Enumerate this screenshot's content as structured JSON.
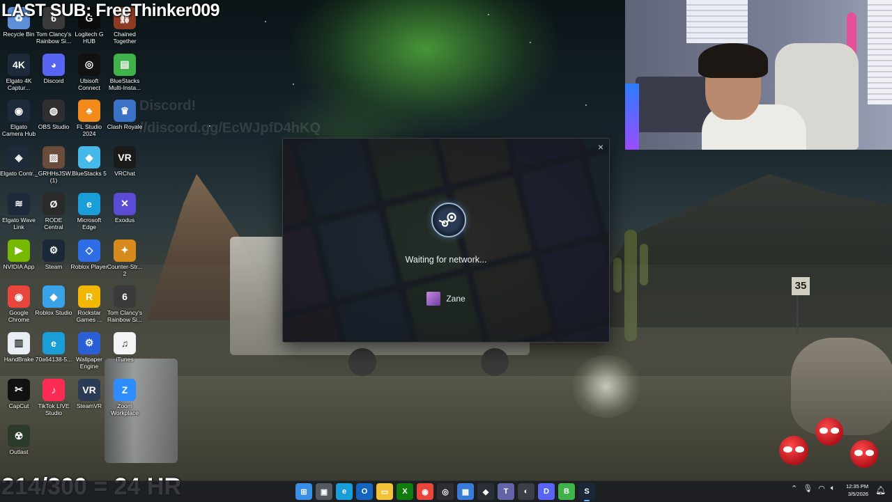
{
  "overlay": {
    "last_sub": "LAST SUB: FreeThinker009",
    "subgoal": "214/300 = 24 HR",
    "faint_line1": "Discord!",
    "faint_line2": "//discord.gg/EcWJpfD4hKQ"
  },
  "desktop_icons": [
    {
      "label": "Recycle Bin",
      "icon": "recycle-bin-icon",
      "color": "#5d8fd6"
    },
    {
      "label": "Tom Clancy's Rainbow Si...",
      "icon": "rainbow-six-icon",
      "color": "#3a3a3a"
    },
    {
      "label": "Logitech G HUB",
      "icon": "logitech-icon",
      "color": "#0b0b0b"
    },
    {
      "label": "Chained Together",
      "icon": "chained-together-icon",
      "color": "#8a3b22"
    },
    {
      "label": "Elgato 4K Captur...",
      "icon": "elgato-4k-icon",
      "color": "#1e2a3a"
    },
    {
      "label": "Discord",
      "icon": "discord-icon",
      "color": "#5865f2"
    },
    {
      "label": "Ubisoft Connect",
      "icon": "ubisoft-icon",
      "color": "#111111"
    },
    {
      "label": "BlueStacks Multi-Insta...",
      "icon": "bluestacks-multi-icon",
      "color": "#3fb24a"
    },
    {
      "label": "Elgato Camera Hub",
      "icon": "elgato-camera-icon",
      "color": "#1e2a3a"
    },
    {
      "label": "OBS Studio",
      "icon": "obs-icon",
      "color": "#302e31"
    },
    {
      "label": "FL Studio 2024",
      "icon": "fl-studio-icon",
      "color": "#f28b1c"
    },
    {
      "label": "Clash Royale",
      "icon": "clash-royale-icon",
      "color": "#3a72c8"
    },
    {
      "label": "Elgato Contr...",
      "icon": "elgato-control-icon",
      "color": "#1e2a3a"
    },
    {
      "label": "_GRHHsJSW... (1)",
      "icon": "image-file-icon",
      "color": "#6b4b3a"
    },
    {
      "label": "BlueStacks 5",
      "icon": "bluestacks-icon",
      "color": "#46b9e8"
    },
    {
      "label": "VRChat",
      "icon": "vrchat-icon",
      "color": "#1a1a1a"
    },
    {
      "label": "Elgato Wave Link",
      "icon": "wave-link-icon",
      "color": "#1e2a3a"
    },
    {
      "label": "RODE Central",
      "icon": "rode-icon",
      "color": "#2a2a2a"
    },
    {
      "label": "Microsoft Edge",
      "icon": "edge-icon",
      "color": "#1a9ed8"
    },
    {
      "label": "Exodus",
      "icon": "exodus-icon",
      "color": "#5b4bd6"
    },
    {
      "label": "NVIDIA App",
      "icon": "nvidia-icon",
      "color": "#76b900"
    },
    {
      "label": "Steam",
      "icon": "steam-icon",
      "color": "#1b2838"
    },
    {
      "label": "Roblox Player",
      "icon": "roblox-icon",
      "color": "#2e6de6"
    },
    {
      "label": "Counter-Str... 2",
      "icon": "counter-strike-icon",
      "color": "#d88a1c"
    },
    {
      "label": "Google Chrome",
      "icon": "chrome-icon",
      "color": "#e8453c"
    },
    {
      "label": "Roblox Studio",
      "icon": "roblox-studio-icon",
      "color": "#3aa3e8"
    },
    {
      "label": "Rockstar Games ...",
      "icon": "rockstar-icon",
      "color": "#f2b705"
    },
    {
      "label": "Tom Clancy's Rainbow Si...",
      "icon": "rainbow-six-icon",
      "color": "#3a3a3a"
    },
    {
      "label": "HandBrake",
      "icon": "handbrake-icon",
      "color": "#e8eef4"
    },
    {
      "label": "70a64138-5...",
      "icon": "edge-file-icon",
      "color": "#1a9ed8"
    },
    {
      "label": "Wallpaper Engine",
      "icon": "wallpaper-engine-icon",
      "color": "#2a5fd6"
    },
    {
      "label": "iTunes",
      "icon": "itunes-icon",
      "color": "#f4f4f4"
    },
    {
      "label": "CapCut",
      "icon": "capcut-icon",
      "color": "#111111"
    },
    {
      "label": "TikTok LIVE Studio",
      "icon": "tiktok-live-icon",
      "color": "#fe2c55"
    },
    {
      "label": "SteamVR",
      "icon": "steamvr-icon",
      "color": "#2b3b55"
    },
    {
      "label": "Zoom Workplace",
      "icon": "zoom-icon",
      "color": "#2d8cff"
    },
    {
      "label": "Outlast",
      "icon": "outlast-icon",
      "color": "#2b3a2b"
    }
  ],
  "dialog": {
    "close_glyph": "×",
    "status": "Waiting for network...",
    "username": "Zane"
  },
  "wallpaper": {
    "sign_text": "35"
  },
  "taskbar": {
    "apps": [
      {
        "name": "start-button",
        "glyph": "⊞",
        "color": "#3a8ee6"
      },
      {
        "name": "task-view-icon",
        "glyph": "▣",
        "color": "#555a60"
      },
      {
        "name": "edge-taskbar-icon",
        "glyph": "e",
        "color": "#1a9ed8"
      },
      {
        "name": "outlook-taskbar-icon",
        "glyph": "O",
        "color": "#1565c0"
      },
      {
        "name": "file-explorer-icon",
        "glyph": "▭",
        "color": "#f2c23a"
      },
      {
        "name": "xbox-taskbar-icon",
        "glyph": "X",
        "color": "#107c10"
      },
      {
        "name": "chrome-taskbar-icon",
        "glyph": "◉",
        "color": "#e8453c"
      },
      {
        "name": "obs-taskbar-icon",
        "glyph": "◎",
        "color": "#302e31"
      },
      {
        "name": "store-taskbar-icon",
        "glyph": "▦",
        "color": "#3a7bd5"
      },
      {
        "name": "alienware-taskbar-icon",
        "glyph": "◆",
        "color": "#2a2f36"
      },
      {
        "name": "teams-taskbar-icon",
        "glyph": "T",
        "color": "#6264a7"
      },
      {
        "name": "unknown-taskbar-icon",
        "glyph": "◐",
        "color": "#3a3f46"
      },
      {
        "name": "discord-taskbar-icon",
        "glyph": "D",
        "color": "#5865f2"
      },
      {
        "name": "bluestacks-taskbar-icon",
        "glyph": "B",
        "color": "#3fb24a"
      },
      {
        "name": "steam-taskbar-icon",
        "glyph": "S",
        "color": "#1b2838"
      }
    ],
    "clock_time": "12:35 PM",
    "clock_date": "3/5/2026"
  }
}
